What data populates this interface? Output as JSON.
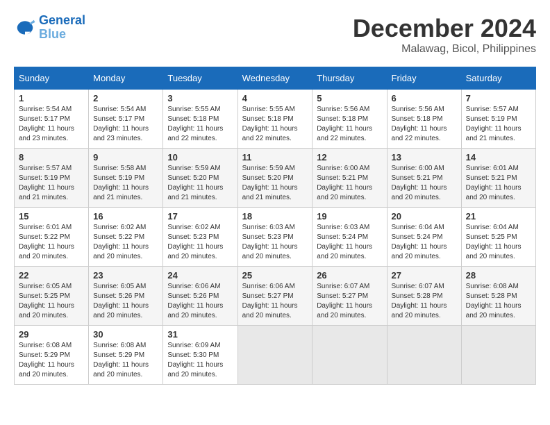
{
  "header": {
    "logo_line1": "General",
    "logo_line2": "Blue",
    "month_year": "December 2024",
    "location": "Malawag, Bicol, Philippines"
  },
  "days_of_week": [
    "Sunday",
    "Monday",
    "Tuesday",
    "Wednesday",
    "Thursday",
    "Friday",
    "Saturday"
  ],
  "weeks": [
    [
      {
        "day": "1",
        "sunrise": "5:54 AM",
        "sunset": "5:17 PM",
        "daylight": "11 hours and 23 minutes."
      },
      {
        "day": "2",
        "sunrise": "5:54 AM",
        "sunset": "5:17 PM",
        "daylight": "11 hours and 23 minutes."
      },
      {
        "day": "3",
        "sunrise": "5:55 AM",
        "sunset": "5:18 PM",
        "daylight": "11 hours and 22 minutes."
      },
      {
        "day": "4",
        "sunrise": "5:55 AM",
        "sunset": "5:18 PM",
        "daylight": "11 hours and 22 minutes."
      },
      {
        "day": "5",
        "sunrise": "5:56 AM",
        "sunset": "5:18 PM",
        "daylight": "11 hours and 22 minutes."
      },
      {
        "day": "6",
        "sunrise": "5:56 AM",
        "sunset": "5:18 PM",
        "daylight": "11 hours and 22 minutes."
      },
      {
        "day": "7",
        "sunrise": "5:57 AM",
        "sunset": "5:19 PM",
        "daylight": "11 hours and 21 minutes."
      }
    ],
    [
      {
        "day": "8",
        "sunrise": "5:57 AM",
        "sunset": "5:19 PM",
        "daylight": "11 hours and 21 minutes."
      },
      {
        "day": "9",
        "sunrise": "5:58 AM",
        "sunset": "5:19 PM",
        "daylight": "11 hours and 21 minutes."
      },
      {
        "day": "10",
        "sunrise": "5:59 AM",
        "sunset": "5:20 PM",
        "daylight": "11 hours and 21 minutes."
      },
      {
        "day": "11",
        "sunrise": "5:59 AM",
        "sunset": "5:20 PM",
        "daylight": "11 hours and 21 minutes."
      },
      {
        "day": "12",
        "sunrise": "6:00 AM",
        "sunset": "5:21 PM",
        "daylight": "11 hours and 20 minutes."
      },
      {
        "day": "13",
        "sunrise": "6:00 AM",
        "sunset": "5:21 PM",
        "daylight": "11 hours and 20 minutes."
      },
      {
        "day": "14",
        "sunrise": "6:01 AM",
        "sunset": "5:21 PM",
        "daylight": "11 hours and 20 minutes."
      }
    ],
    [
      {
        "day": "15",
        "sunrise": "6:01 AM",
        "sunset": "5:22 PM",
        "daylight": "11 hours and 20 minutes."
      },
      {
        "day": "16",
        "sunrise": "6:02 AM",
        "sunset": "5:22 PM",
        "daylight": "11 hours and 20 minutes."
      },
      {
        "day": "17",
        "sunrise": "6:02 AM",
        "sunset": "5:23 PM",
        "daylight": "11 hours and 20 minutes."
      },
      {
        "day": "18",
        "sunrise": "6:03 AM",
        "sunset": "5:23 PM",
        "daylight": "11 hours and 20 minutes."
      },
      {
        "day": "19",
        "sunrise": "6:03 AM",
        "sunset": "5:24 PM",
        "daylight": "11 hours and 20 minutes."
      },
      {
        "day": "20",
        "sunrise": "6:04 AM",
        "sunset": "5:24 PM",
        "daylight": "11 hours and 20 minutes."
      },
      {
        "day": "21",
        "sunrise": "6:04 AM",
        "sunset": "5:25 PM",
        "daylight": "11 hours and 20 minutes."
      }
    ],
    [
      {
        "day": "22",
        "sunrise": "6:05 AM",
        "sunset": "5:25 PM",
        "daylight": "11 hours and 20 minutes."
      },
      {
        "day": "23",
        "sunrise": "6:05 AM",
        "sunset": "5:26 PM",
        "daylight": "11 hours and 20 minutes."
      },
      {
        "day": "24",
        "sunrise": "6:06 AM",
        "sunset": "5:26 PM",
        "daylight": "11 hours and 20 minutes."
      },
      {
        "day": "25",
        "sunrise": "6:06 AM",
        "sunset": "5:27 PM",
        "daylight": "11 hours and 20 minutes."
      },
      {
        "day": "26",
        "sunrise": "6:07 AM",
        "sunset": "5:27 PM",
        "daylight": "11 hours and 20 minutes."
      },
      {
        "day": "27",
        "sunrise": "6:07 AM",
        "sunset": "5:28 PM",
        "daylight": "11 hours and 20 minutes."
      },
      {
        "day": "28",
        "sunrise": "6:08 AM",
        "sunset": "5:28 PM",
        "daylight": "11 hours and 20 minutes."
      }
    ],
    [
      {
        "day": "29",
        "sunrise": "6:08 AM",
        "sunset": "5:29 PM",
        "daylight": "11 hours and 20 minutes."
      },
      {
        "day": "30",
        "sunrise": "6:08 AM",
        "sunset": "5:29 PM",
        "daylight": "11 hours and 20 minutes."
      },
      {
        "day": "31",
        "sunrise": "6:09 AM",
        "sunset": "5:30 PM",
        "daylight": "11 hours and 20 minutes."
      },
      null,
      null,
      null,
      null
    ]
  ]
}
